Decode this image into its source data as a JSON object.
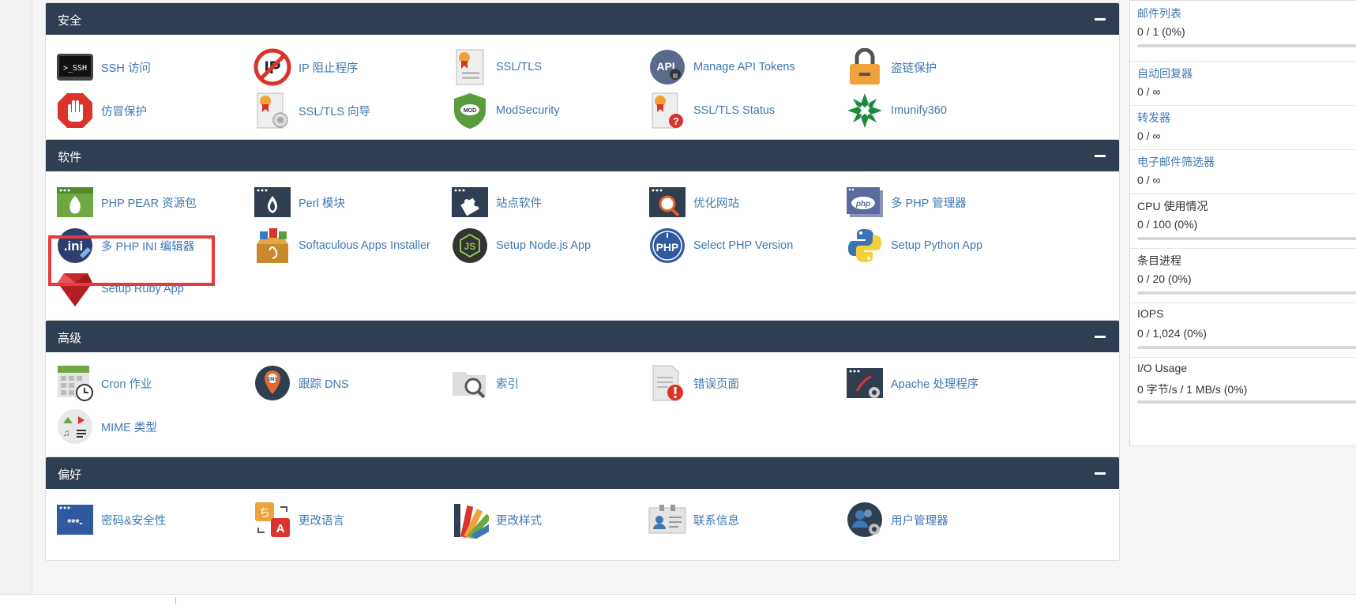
{
  "panels": {
    "security": {
      "title": "安全",
      "items": [
        "SSH 访问",
        "IP 阻止程序",
        "SSL/TLS",
        "Manage API Tokens",
        "盗链保护",
        "仿冒保护",
        "SSL/TLS 向导",
        "ModSecurity",
        "SSL/TLS Status",
        "Imunify360"
      ]
    },
    "software": {
      "title": "软件",
      "items": [
        "PHP PEAR 资源包",
        "Perl 模块",
        "站点软件",
        "优化网站",
        "多 PHP 管理器",
        "多 PHP INI 编辑器",
        "Softaculous Apps Installer",
        "Setup Node.js App",
        "Select PHP Version",
        "Setup Python App",
        "Setup Ruby App"
      ]
    },
    "advanced": {
      "title": "高级",
      "items": [
        "Cron 作业",
        "跟踪 DNS",
        "索引",
        "错误页面",
        "Apache 处理程序",
        "MIME 类型"
      ]
    },
    "preferences": {
      "title": "偏好",
      "items": [
        "密码&安全性",
        "更改语言",
        "更改样式",
        "联系信息",
        "用户管理器"
      ]
    }
  },
  "icon_texts": {
    "ssh": ">_SSH",
    "api": "API",
    "mod": "MOD",
    "ini": ".ini",
    "php": "php",
    "php_circle": "PHP",
    "dns": "DNS",
    "js": "JS",
    "pwd": "***-",
    "lang_a": "ち",
    "lang_b": "A"
  },
  "stats": [
    {
      "name": "邮件列表",
      "value": "0 / 1   (0%)",
      "link": true,
      "bar": 0
    },
    {
      "name": "自动回复器",
      "value": "0 / ∞",
      "link": true
    },
    {
      "name": "转发器",
      "value": "0 / ∞",
      "link": true
    },
    {
      "name": "电子邮件筛选器",
      "value": "0 / ∞",
      "link": true
    },
    {
      "name": "CPU 使用情况",
      "value": "0 / 100   (0%)",
      "link": false,
      "bar": 0
    },
    {
      "name": "条目进程",
      "value": "0 / 20   (0%)",
      "link": false,
      "bar": 0
    },
    {
      "name": "IOPS",
      "value": "0 / 1,024   (0%)",
      "link": false,
      "bar": 0
    },
    {
      "name": "I/O Usage",
      "value": "0 字节/s / 1 MB/s   (0%)",
      "link": false,
      "bar": 0
    }
  ],
  "colors": {
    "header": "#2f3e50",
    "link": "#3e78b3",
    "highlight": "#e83a3a"
  }
}
